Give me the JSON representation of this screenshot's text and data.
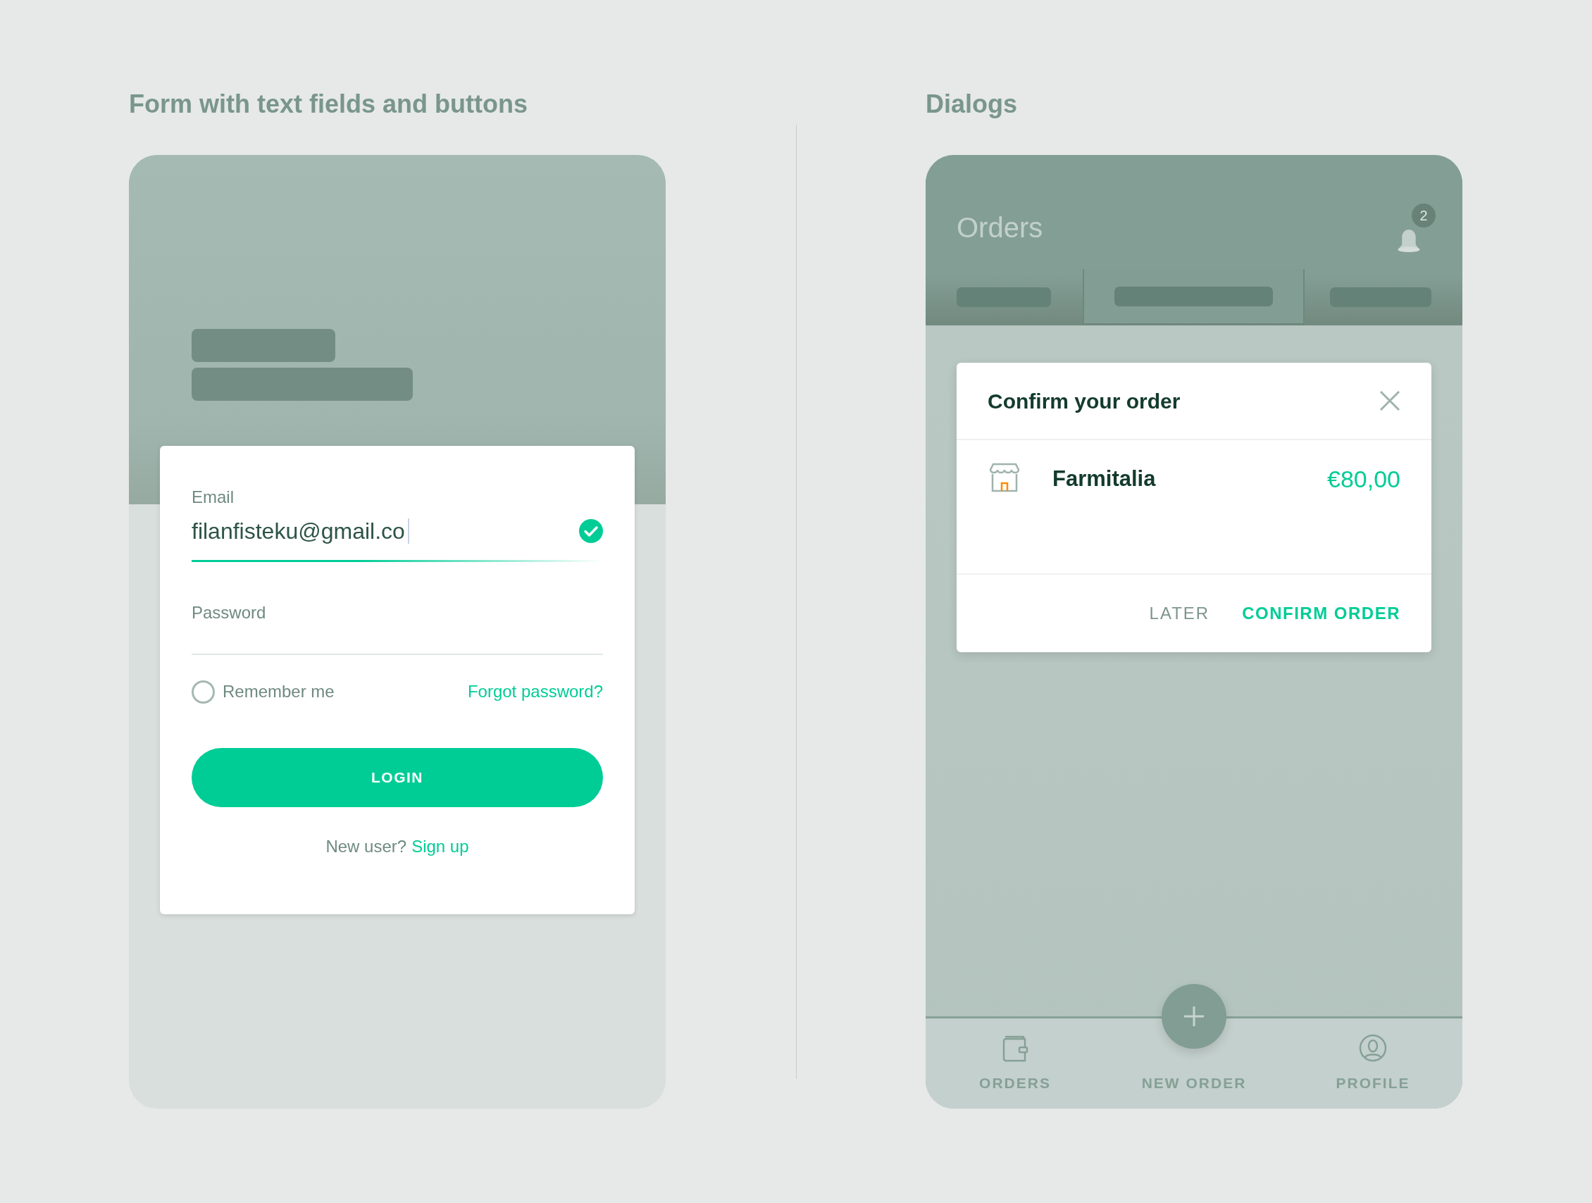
{
  "form_section": {
    "heading": "Form with text fields and buttons",
    "login_card": {
      "fields": [
        {
          "kind": "text",
          "label": "Email",
          "value": "filanfisteku@gmail.co",
          "focused": true,
          "valid": true
        },
        {
          "kind": "password",
          "placeholder": "Password",
          "focused": false,
          "valid": false
        }
      ],
      "remember": {
        "label": "Remember me",
        "checked": false
      },
      "forgot_link": "Forgot password?",
      "login_button": "LOGIN",
      "signup_prompt": "New user?",
      "signup_link": "Sign up"
    }
  },
  "dialogs_section": {
    "heading": "Dialogs",
    "app_bar": {
      "title": "Orders",
      "notification_count": "2"
    },
    "tabs": [
      {
        "selected": false
      },
      {
        "selected": true
      },
      {
        "selected": false
      }
    ],
    "dialog": {
      "title": "Confirm your order",
      "item": {
        "name": "Farmitalia",
        "price": "€80,00"
      },
      "buttons": [
        {
          "label": "LATER",
          "kind": "secondary"
        },
        {
          "label": "CONFIRM ORDER",
          "kind": "primary"
        }
      ]
    },
    "bottom_nav": [
      {
        "label": "ORDERS",
        "kind": "wallet"
      },
      {
        "label": "NEW ORDER",
        "kind": "fab"
      },
      {
        "label": "PROFILE",
        "kind": "profile"
      }
    ]
  }
}
